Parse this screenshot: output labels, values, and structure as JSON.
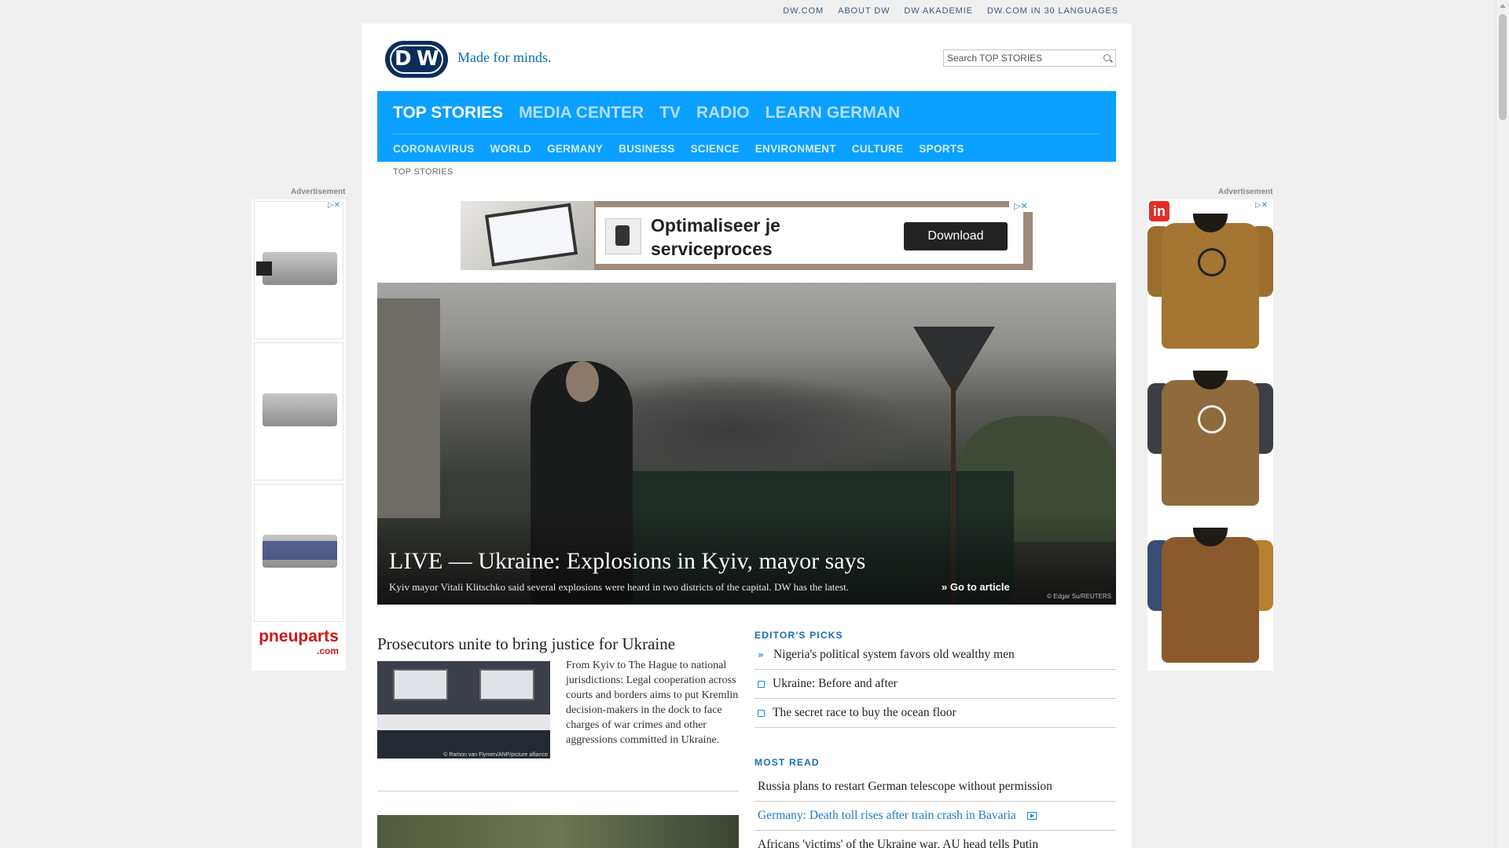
{
  "utility_links": [
    "DW.COM",
    "ABOUT DW",
    "DW AKADEMIE",
    "DW.COM IN 30 LANGUAGES"
  ],
  "brand": {
    "logo_text_d": "D",
    "logo_text_w": "W",
    "tagline": "Made for minds."
  },
  "search": {
    "placeholder": "Search TOP STORIES"
  },
  "nav": {
    "main": [
      "TOP STORIES",
      "MEDIA CENTER",
      "TV",
      "RADIO",
      "LEARN GERMAN"
    ],
    "active": "TOP STORIES",
    "sub": [
      "CORONAVIRUS",
      "WORLD",
      "GERMANY",
      "BUSINESS",
      "SCIENCE",
      "ENVIRONMENT",
      "CULTURE",
      "SPORTS"
    ]
  },
  "breadcrumb": "TOP STORIES",
  "ads": {
    "label": "Advertisement",
    "banner_text": "Optimaliseer je\nserviceproces",
    "banner_button": "Download",
    "adchoice_glyph": "▷✕",
    "left_brand": "pneuparts",
    "left_brand_sub": ".com",
    "right_badge": "in"
  },
  "hero": {
    "title": "LIVE — Ukraine: Explosions in Kyiv, mayor says",
    "teaser": "Kyiv mayor Vitali Klitschko said several explosions were heard in two districts of the capital. DW has the latest.",
    "goto": "» Go to article",
    "credit": "© Edgar Su/REUTERS"
  },
  "story1": {
    "title": "Prosecutors unite to bring justice for Ukraine",
    "text": "From Kyiv to The Hague to national jurisdictions: Legal cooperation across courts and borders aims to put Kremlin decision-makers in the dock to face charges of war crimes and other aggressions committed in Ukraine.",
    "image_credit": "© Ramon van Flymen/ANP/picture alliance"
  },
  "editors_picks": {
    "heading": "EDITOR'S PICKS",
    "items": [
      {
        "label": "Nigeria's political system favors old wealthy men",
        "icon": "double-chevron-icon"
      },
      {
        "label": "Ukraine: Before and after",
        "icon": "external-link-icon"
      },
      {
        "label": "The secret race to buy the ocean floor",
        "icon": "external-link-icon"
      }
    ]
  },
  "most_read": {
    "heading": "MOST READ",
    "items": [
      {
        "label": "Russia plans to restart German telescope without permission"
      },
      {
        "label": "Germany: Death toll rises after train crash in Bavaria",
        "icon": "video-icon"
      },
      {
        "label": "Africans 'victims' of the Ukraine war, AU head tells Putin"
      }
    ]
  },
  "colors": {
    "nav_bg": "#0aa0ff",
    "logo_bg": "#0a2d5c",
    "accent": "#1a6db3"
  }
}
